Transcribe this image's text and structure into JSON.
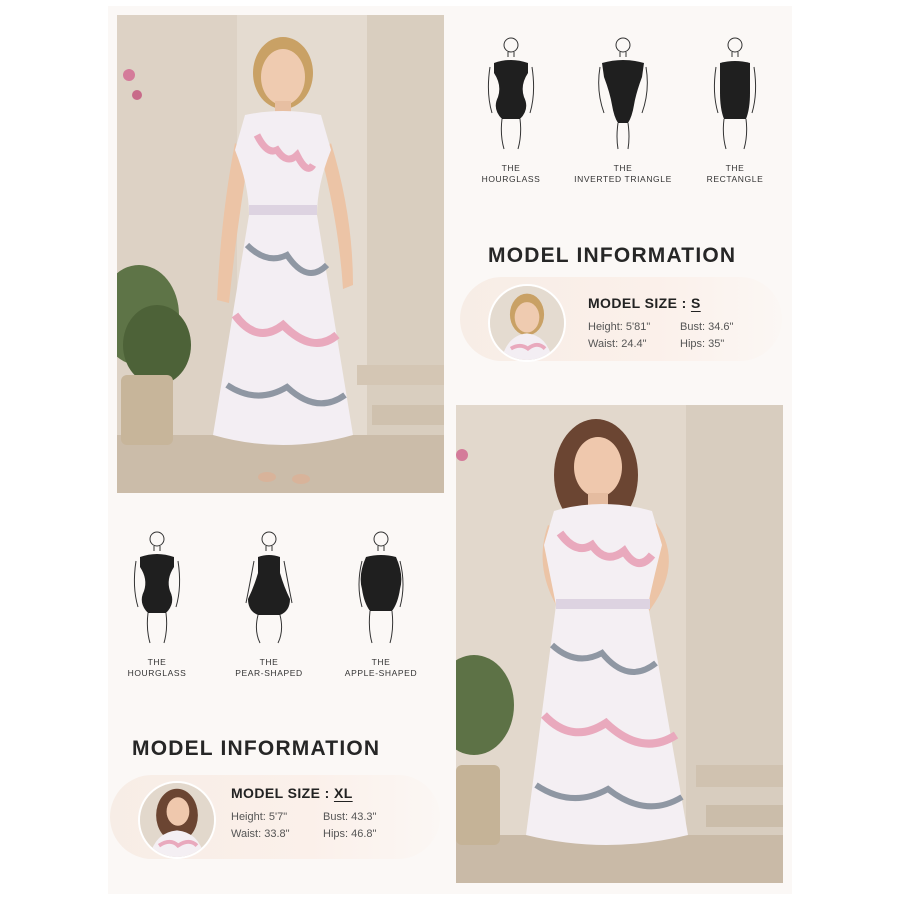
{
  "top_block": {
    "shapes": [
      {
        "line1": "THE",
        "line2": "HOURGLASS",
        "icon": "hourglass-body-icon"
      },
      {
        "line1": "THE",
        "line2": "INVERTED TRIANGLE",
        "icon": "inverted-triangle-body-icon"
      },
      {
        "line1": "THE",
        "line2": "RECTANGLE",
        "icon": "rectangle-body-icon"
      }
    ],
    "info_title": "MODEL INFORMATION",
    "size_label": "MODEL SIZE : ",
    "size_value": "S",
    "height": "Height: 5'81\"",
    "bust": "Bust: 34.6\"",
    "waist": "Waist: 24.4\"",
    "hips": "Hips: 35\""
  },
  "bottom_block": {
    "shapes": [
      {
        "line1": "THE",
        "line2": "HOURGLASS",
        "icon": "hourglass-body-icon"
      },
      {
        "line1": "THE",
        "line2": "PEAR-SHAPED",
        "icon": "pear-body-icon"
      },
      {
        "line1": "THE",
        "line2": "APPLE-SHAPED",
        "icon": "apple-body-icon"
      }
    ],
    "info_title": "MODEL INFORMATION",
    "size_label": "MODEL SIZE : ",
    "size_value": "XL",
    "height": "Height: 5'7\"",
    "bust": "Bust: 43.3\"",
    "waist": "Waist: 33.8\"",
    "hips": "Hips: 46.8\""
  },
  "colors": {
    "background": "#fbf8f6",
    "pill": "#f7ede6",
    "swimsuit": "#1f1f1f",
    "dress_pink": "#e9a9bd",
    "dress_grey": "#8f97a3"
  }
}
